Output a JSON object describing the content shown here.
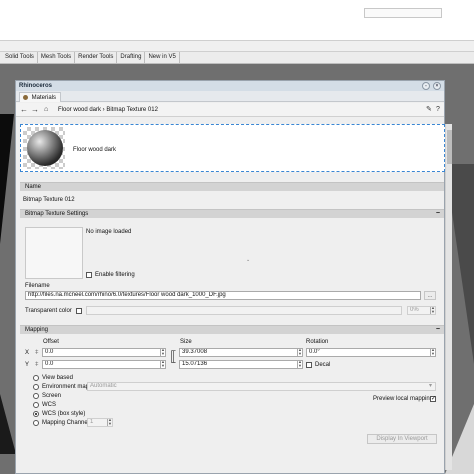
{
  "toolbar_tabs": [
    "Solid Tools",
    "Mesh Tools",
    "Render Tools",
    "Drafting",
    "New in V5"
  ],
  "panel": {
    "title": "Rhinoceros",
    "tab_label": "Materials",
    "breadcrumb": "Floor wood dark  ›  Bitmap Texture 012",
    "preview_name": "Floor wood dark"
  },
  "sections": {
    "name": {
      "header": "Name",
      "value": "Bitmap Texture 012"
    },
    "bitmap": {
      "header": "Bitmap Texture Settings",
      "no_image_text": "No image loaded",
      "enable_filtering_label": "Enable filtering",
      "enable_filtering_checked": false,
      "filename_label": "Filename",
      "filename_value": "http://files.na.mcneel.com/rhino/6.0/textures/Floor wood dark_1000_DF.jpg",
      "browse_label": "...",
      "transparent_color_label": "Transparent color",
      "transparent_percent": "0%"
    },
    "mapping": {
      "header": "Mapping",
      "col_offset": "Offset",
      "col_size": "Size",
      "col_rotation": "Rotation",
      "row_x_label": "X",
      "row_y_label": "Y",
      "offset_x": "0.0",
      "offset_y": "0.0",
      "size_x": "39.37008",
      "size_y": "15.07136",
      "rotation": "0.0°",
      "decal_label": "Decal",
      "options": [
        "View based",
        "Environment map",
        "Screen",
        "WCS",
        "WCS (box style)",
        "Mapping Channel"
      ],
      "selected_option": "WCS (box style)",
      "env_map_value": "Automatic",
      "mapping_channel_value": "1",
      "preview_local_mapping_label": "Preview local mapping",
      "preview_local_mapping_checked": true,
      "display_in_viewport_label": "Display In Viewport"
    }
  },
  "icons": {
    "back": "back-arrow-icon",
    "forward": "forward-arrow-icon",
    "home": "home-icon",
    "tools": "wrench-icon",
    "help": "help-icon"
  },
  "colors": {
    "accent_dashed": "#3a86d3",
    "panel_title_bg": "#d4dde6"
  }
}
